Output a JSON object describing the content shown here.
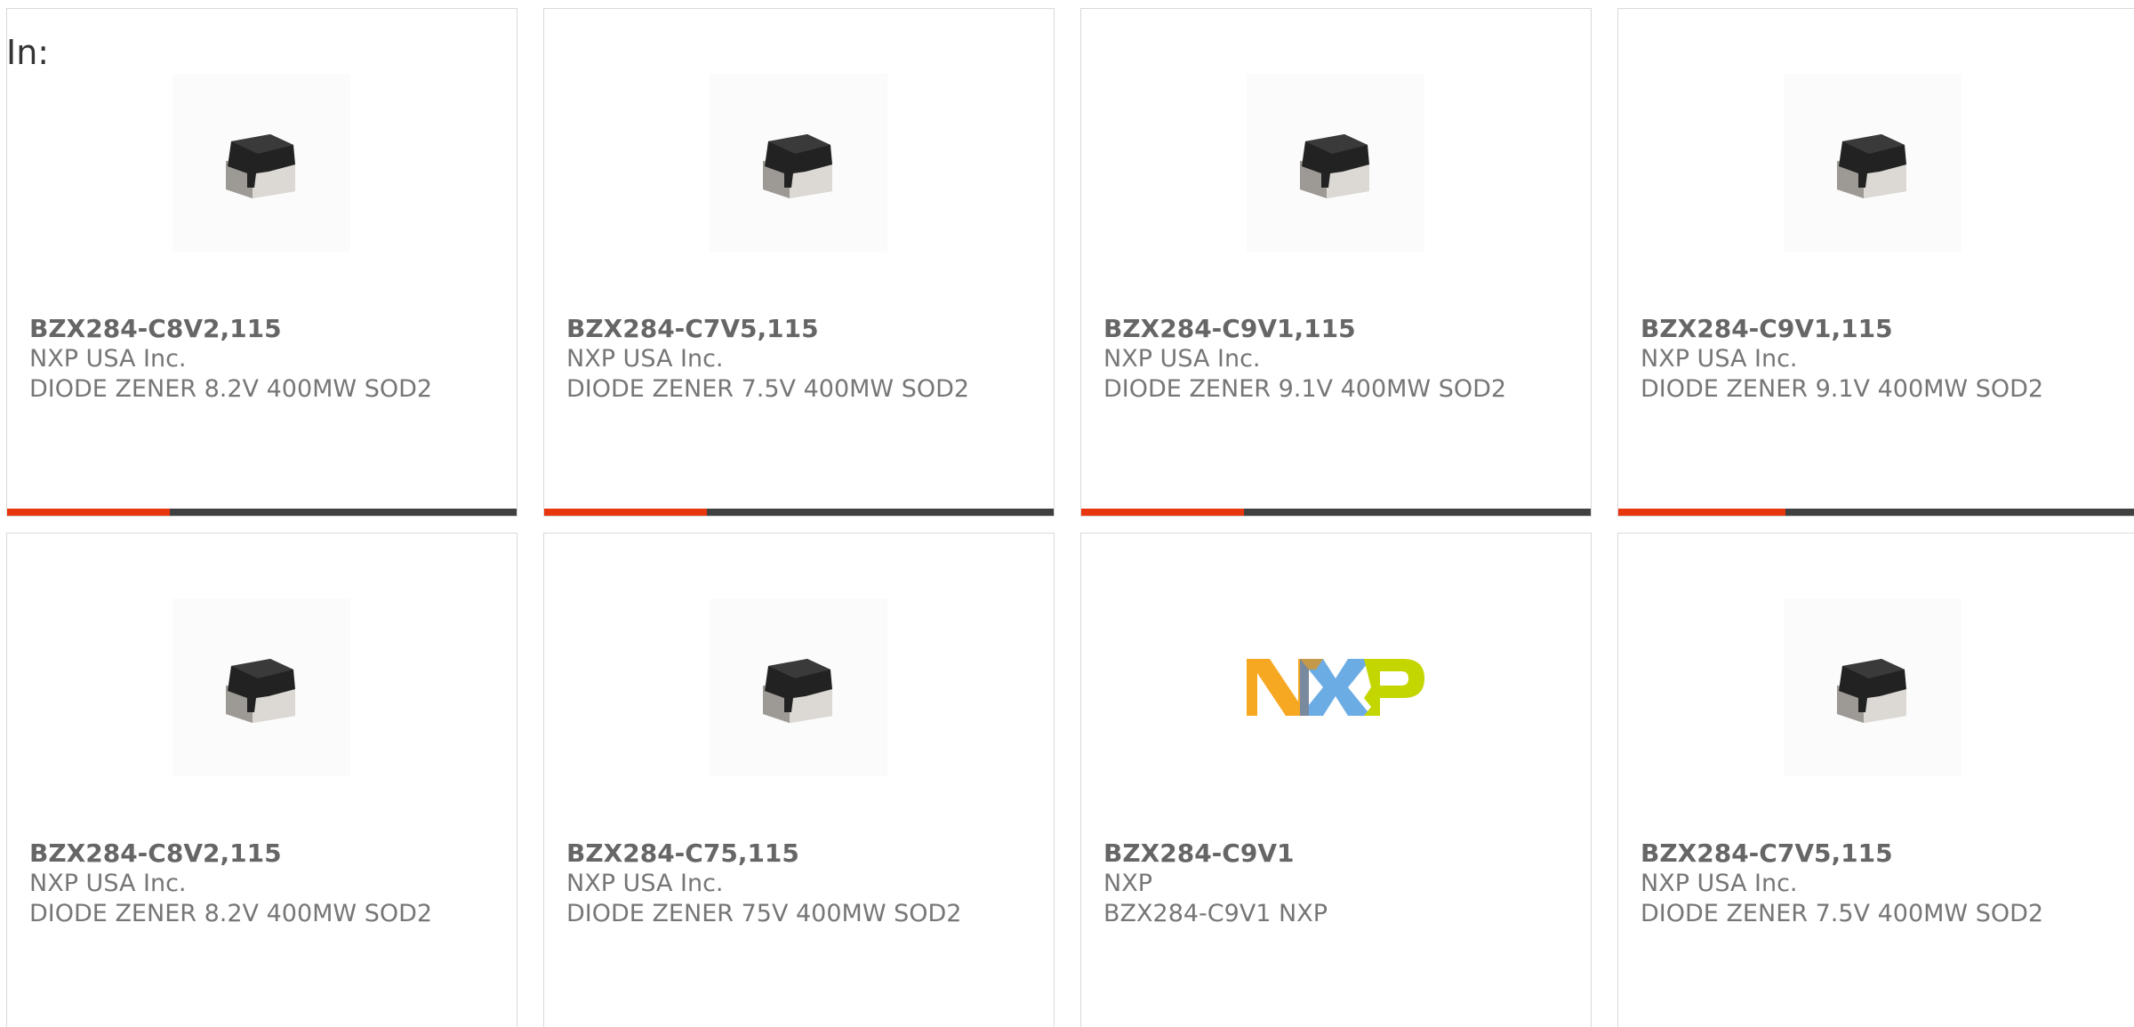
{
  "header": {
    "label": "In:"
  },
  "colors": {
    "accent": "#e8360e",
    "bar_track": "#3f4040"
  },
  "products": [
    {
      "part": "BZX284-C8V2,115",
      "manufacturer": "NXP USA Inc.",
      "description": "DIODE ZENER 8.2V 400MW SOD2",
      "image": "diode-chip-icon",
      "progress": 0.32
    },
    {
      "part": "BZX284-C7V5,115",
      "manufacturer": "NXP USA Inc.",
      "description": "DIODE ZENER 7.5V 400MW SOD2",
      "image": "diode-chip-icon",
      "progress": 0.32
    },
    {
      "part": "BZX284-C9V1,115",
      "manufacturer": "NXP USA Inc.",
      "description": "DIODE ZENER 9.1V 400MW SOD2",
      "image": "diode-chip-icon",
      "progress": 0.32
    },
    {
      "part": "BZX284-C9V1,115",
      "manufacturer": "NXP USA Inc.",
      "description": "DIODE ZENER 9.1V 400MW SOD2",
      "image": "diode-chip-icon",
      "progress": 0.32
    },
    {
      "part": "BZX284-C8V2,115",
      "manufacturer": "NXP USA Inc.",
      "description": "DIODE ZENER 8.2V 400MW SOD2",
      "image": "diode-chip-icon"
    },
    {
      "part": "BZX284-C75,115",
      "manufacturer": "NXP USA Inc.",
      "description": "DIODE ZENER 75V 400MW SOD2",
      "image": "diode-chip-icon"
    },
    {
      "part": "BZX284-C9V1",
      "manufacturer": "NXP",
      "description": "BZX284-C9V1 NXP",
      "image": "nxp-logo"
    },
    {
      "part": "BZX284-C7V5,115",
      "manufacturer": "NXP USA Inc.",
      "description": "DIODE ZENER 7.5V 400MW SOD2",
      "image": "diode-chip-icon"
    }
  ]
}
